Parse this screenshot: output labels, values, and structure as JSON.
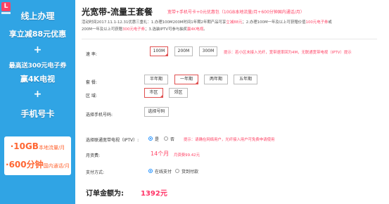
{
  "banner": {
    "logo_char": "L",
    "line1": "线上办理",
    "line2": "享立减88元优惠",
    "plus": "+",
    "line3": "最高送300元电子券",
    "line4": "赢4K电视",
    "line5": "手机号卡",
    "sim_row1_big": "·10GB",
    "sim_row1_small": "本地流量/月",
    "sim_row2_big": "·600分钟",
    "sim_row2_small": "国内通话/月"
  },
  "header": {
    "title": "光宽带-流量王套餐",
    "promo": "宽带+手机号卡+0元优惠包（10GB本地流量/月+600分钟国内通话/月）"
  },
  "activity": {
    "line1_a": "活动时间2017.11.1-12.31优惠三重礼：1.办理100M200M时间1年期2年期产品可享",
    "line1_hl": "立减88元",
    "line1_b": "；2.办理100M一年及以上可获赠价值",
    "line1_hl2": "100元电子券",
    "line1_c": "或",
    "line2_a": "200M一年及以上可获赠",
    "line2_hl": "300元电子券",
    "line2_b": "；3.选装IPTV可参与抽奖",
    "line2_hl2": "赢4K电视",
    "line2_c": "。"
  },
  "form": {
    "speed": {
      "label": "速 率:",
      "options": [
        "100M",
        "200M",
        "300M"
      ],
      "selected": "100M",
      "hint": "提示：若小区未接入光纤，宽带速率回为4M，无联通宽带电视（IPTV）提示"
    },
    "plan": {
      "label": "套 餐:",
      "options": [
        "半年期",
        "一年期",
        "两年期",
        "五年期"
      ],
      "selected": "一年期"
    },
    "area": {
      "label": "区 域:",
      "options": [
        "市区",
        "郊区"
      ],
      "selected": "市区"
    },
    "phone": {
      "label": "选择手机号码:",
      "button": "选择号码"
    },
    "iptv": {
      "label": "选择联通宽带电视（IPTV）:",
      "yes": "是",
      "no": "否",
      "selected": "是",
      "hint": "提示：请确在网络用户，光纤接入用户可免费申请使用"
    },
    "monthly_fee": {
      "label": "月资费:",
      "value": "14个月",
      "sub": "月资费99.42元"
    },
    "payment": {
      "label": "支付方式:",
      "online": "在线支付",
      "cod": "货到付款",
      "selected": "在线支付"
    }
  },
  "total": {
    "label": "订单金额为:",
    "value": "1392元"
  },
  "colors": {
    "banner_blue": "#30a4e4",
    "accent_red": "#ff4466",
    "radio_blue": "#1e90ff"
  }
}
